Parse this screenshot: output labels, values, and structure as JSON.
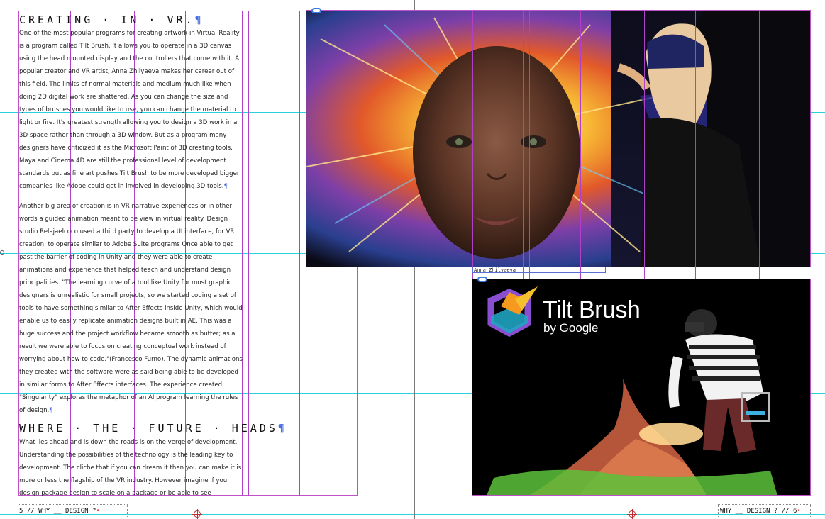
{
  "left_page": {
    "heading_1": "CREATING · IN · VR.",
    "paragraph_1": "One of the most popular programs for creating artwork in Virtual Reality is a program called Tilt Brush. It allows you to operate in a 3D canvas using the head mounted display and the controllers that come with it. A popular creator and VR artist, Anna Zhilyaeva makes her career out of this field. The limits of normal materials and medium much like when doing 2D digital work are shattered. As you can change the size and types of brushes you would like to use, you can change the material to light or fire. It's greatest strength allowing you to design a 3D work in a 3D space rather than through a 3D window. But as a program many designers have criticized it as the Microsoft Paint of 3D creating tools. Maya and Cinema 4D are still the professional level of development standards but as fine art pushes Tilt Brush to be more developed bigger companies like Adobe could get in involved in developing 3D tools.",
    "paragraph_2": "Another big area of creation is in VR narrative experiences or in other words a guided animation meant to be view in virtual reality. Design studio Relajaelcoco used a third party to develop a UI interface, for VR creation, to operate similar to Adobe Suite programs Once able to get past the barrier of coding in Unity and they were able to create animations and experience that helped teach and understand design principalities. \"The learning curve of a tool like Unity for most graphic designers is unrealistic for small projects, so we started coding a set of tools to have something similar to After Effects inside Unity, which would enable us to easily replicate animation designs built in AE. This was a huge success and the project workflow became smooth as butter; as a result we were able to focus on creating conceptual work instead of worrying about how to code.\"(Francesco Furno). The dynamic animations they created with the software were as said being able to be developed in similar forms to After Effects interfaces. The experience created \"Singularity\" explores the metaphor of an AI program learning the rules of design.",
    "heading_2": "WHERE · THE · FUTURE · HEADS",
    "paragraph_3": "What lies ahead and is down the roads is on the verge of development. Understanding the possibilities of the technology is the leading key to development.  The cliche that if you can dream it then you can make it is more or less the flagship of the VR industry. However imagine if you design package design to scale on a package or be able to see prototypes",
    "folio": "5 // WHY __ DESIGN ?"
  },
  "right_page": {
    "caption": "Anna Zhilyaeva",
    "tilt_brush_title": "Tilt Brush",
    "tilt_brush_sub": "by Google",
    "folio": "WHY __ DESIGN ? // 6"
  },
  "pilcrow": "¶",
  "colors": {
    "guide": "#28d2dc",
    "column": "#b040c8",
    "link": "#3d7be0",
    "marker": "#e02020"
  }
}
